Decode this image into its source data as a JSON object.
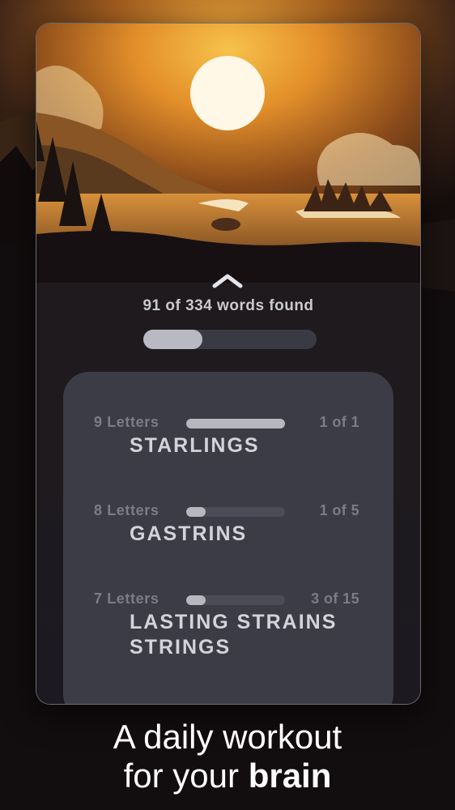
{
  "progress": {
    "words_found_text": "91 of 334 words found",
    "found": 91,
    "total": 334
  },
  "groups": [
    {
      "label": "9 Letters",
      "progress_text": "1 of 1",
      "fraction": 1.0,
      "words": [
        "STARLINGS"
      ]
    },
    {
      "label": "8 Letters",
      "progress_text": "1 of 5",
      "fraction": 0.2,
      "words": [
        "GASTRINS"
      ]
    },
    {
      "label": "7 Letters",
      "progress_text": "3 of 15",
      "fraction": 0.2,
      "words": [
        "LASTING STRAINS",
        "STRINGS"
      ]
    }
  ],
  "tagline": {
    "line1": "A daily workout",
    "line2_prefix": "for your ",
    "line2_bold": "brain"
  },
  "colors": {
    "sky_top": "#2a1a12",
    "sun_glow": "#f5b53a",
    "card_bg": "#3c3c47",
    "text_light": "#d3d3da",
    "text_muted": "#7c7c87"
  },
  "icons": [
    "chevron-up-icon",
    "sun-icon"
  ]
}
